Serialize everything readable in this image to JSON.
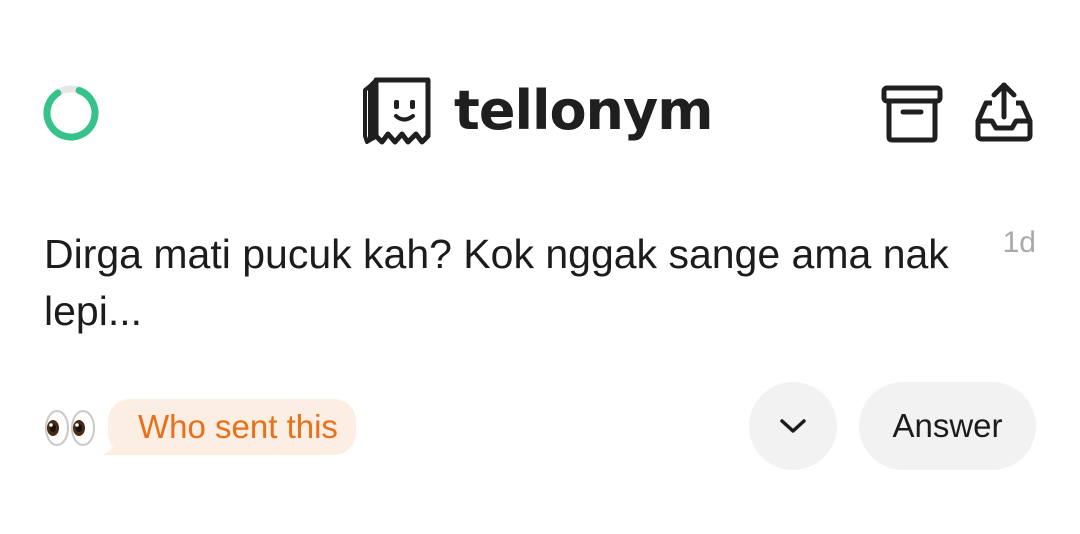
{
  "header": {
    "brand_name": "tellonym",
    "progress": 0.85,
    "icons": [
      "progress-ring-icon",
      "tellonym-logo-icon",
      "archive-icon",
      "share-inbox-icon"
    ]
  },
  "message": {
    "text": "Dirga mati pucuk kah? Kok nggak sange ama nak lepi...",
    "time": "1d"
  },
  "actions": {
    "reveal_emoji": "👀",
    "who_sent_label": "Who sent this",
    "expand_icon": "chevron-down-icon",
    "answer_label": "Answer"
  },
  "colors": {
    "progress_green": "#35c28b",
    "progress_track": "#e6e6e6",
    "who_sent_text": "#e8701a",
    "who_sent_bg": "#fdeee3",
    "button_bg": "#f2f2f2",
    "timestamp": "#a9a9a9"
  }
}
